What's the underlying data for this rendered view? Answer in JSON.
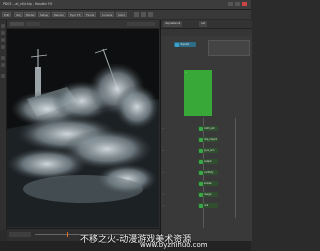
{
  "window": {
    "title": "PD03 ...el_v04.hip - Houdini FX"
  },
  "toolbar": {
    "items": [
      "Edit",
      "Obj",
      "Model",
      "Setup",
      "Render",
      "Pyro FX",
      "Fluids",
      "Crowds",
      "Solid"
    ]
  },
  "node_panel": {
    "tabs": [
      "dopnetwork",
      "out"
    ],
    "sticky_text": "...",
    "nodes": [
      {
        "label": "dopnet1",
        "color": "#3aa0d0"
      },
      {
        "label": "cloth_sim",
        "color": "#3aa848"
      },
      {
        "label": "dop_import",
        "color": "#3aa848"
      },
      {
        "label": "pyro_sim",
        "color": "#3aa848"
      },
      {
        "label": "output",
        "color": "#3aa848"
      },
      {
        "label": "vorticity",
        "color": "#3aa848"
      },
      {
        "label": "smoke",
        "color": "#3aa848"
      },
      {
        "label": "merge",
        "color": "#3aa848"
      },
      {
        "label": "null",
        "color": "#3aa848"
      }
    ],
    "side_labels": [
      "...",
      "...",
      "...",
      "...",
      "..."
    ]
  },
  "watermark": {
    "line1": "不移之火-动漫游戏美术资源",
    "line2": "www.byzhihuo.com"
  },
  "colors": {
    "accent": "#3aa848",
    "sticky": "#38a838",
    "viewer_bg": "#101010"
  }
}
